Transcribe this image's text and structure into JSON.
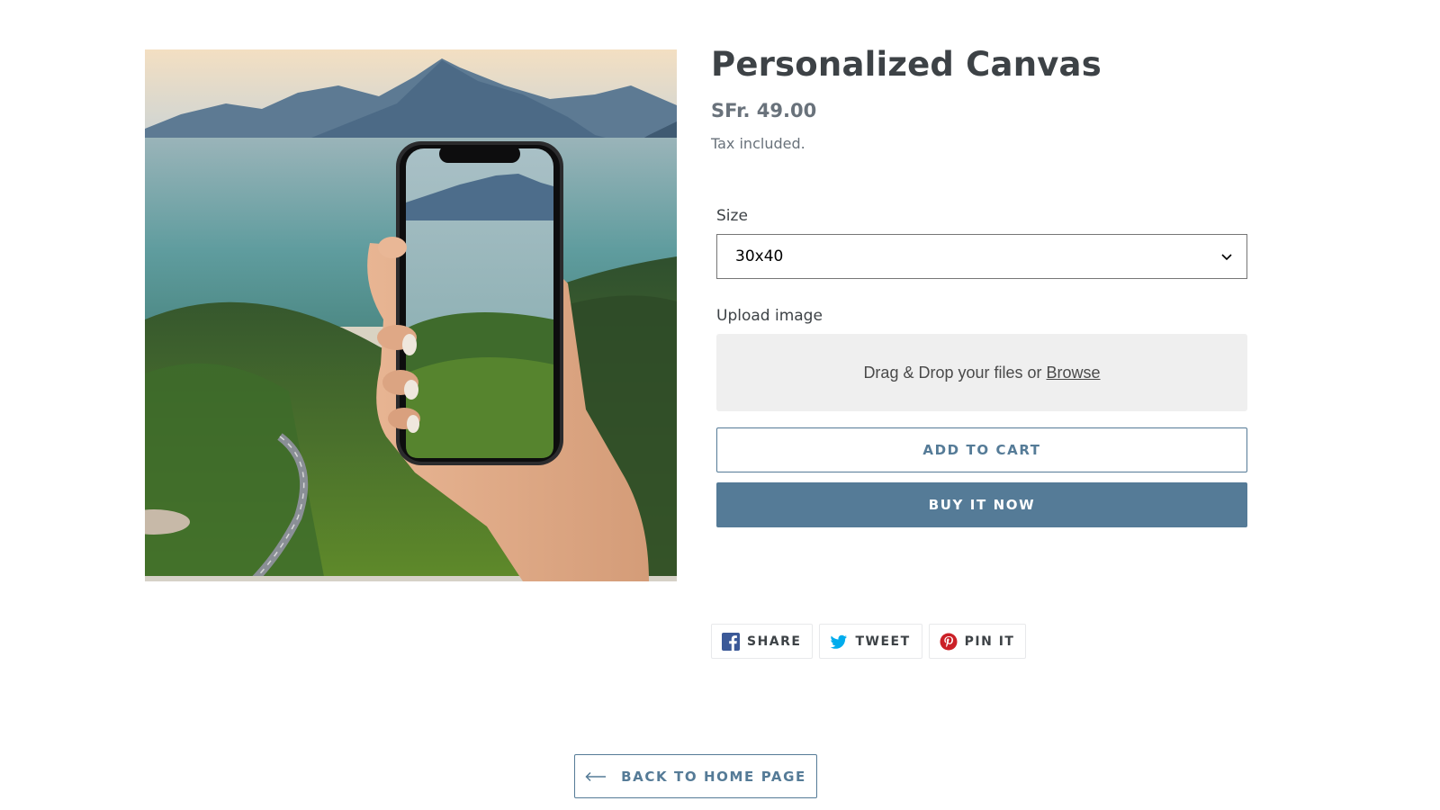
{
  "product": {
    "title": "Personalized Canvas",
    "price": "SFr. 49.00",
    "tax_note": "Tax included."
  },
  "options": {
    "size_label": "Size",
    "size_value": "30x40",
    "upload_label": "Upload image",
    "dropzone_text": "Drag & Drop your files or",
    "dropzone_link": "Browse"
  },
  "actions": {
    "add_to_cart": "Add to cart",
    "buy_now": "Buy it now"
  },
  "share": [
    {
      "label": "Share",
      "icon": "facebook-icon",
      "color": "#3b5998"
    },
    {
      "label": "Tweet",
      "icon": "twitter-icon",
      "color": "#00aced"
    },
    {
      "label": "Pin it",
      "icon": "pinterest-icon",
      "color": "#cb2027"
    }
  ],
  "footer": {
    "back_label": "Back to home page"
  },
  "colors": {
    "accent": "#557b97",
    "text": "#3d4246",
    "muted": "#69727b"
  }
}
